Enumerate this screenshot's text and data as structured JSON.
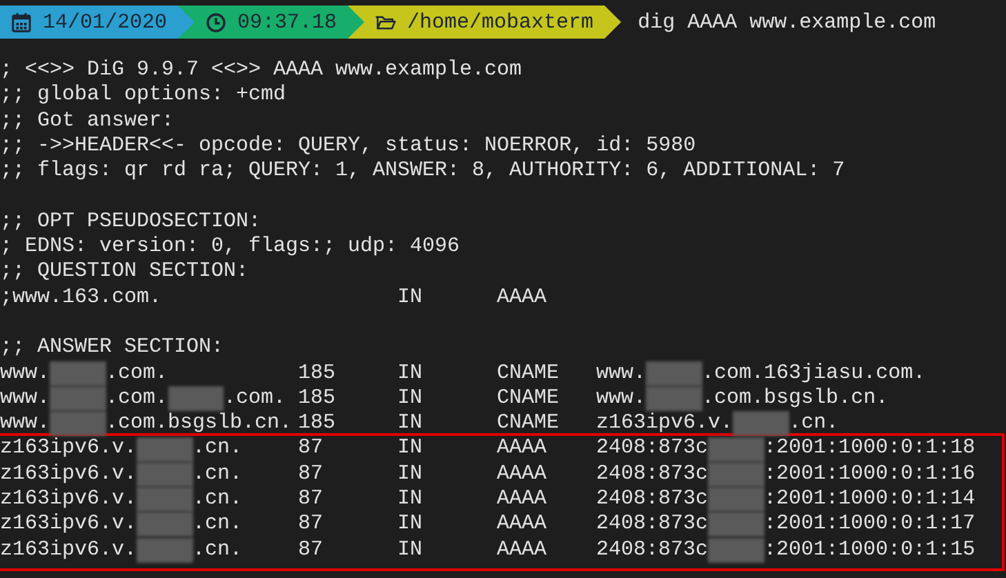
{
  "prompt": {
    "segments": [
      {
        "kind": "date",
        "text": "14/01/2020",
        "color": "#2a9fd0"
      },
      {
        "kind": "time",
        "text": "09:37.18",
        "color": "#17ad6a"
      },
      {
        "kind": "folder",
        "text": "/home/mobaxterm",
        "color": "#c5c51c"
      }
    ],
    "command": "dig AAAA www.example.com"
  },
  "header_lines": [
    "; <<>> DiG 9.9.7 <<>> AAAA www.example.com",
    ";; global options: +cmd",
    ";; Got answer:",
    ";; ->>HEADER<<- opcode: QUERY, status: NOERROR, id: 5980",
    ";; flags: qr rd ra; QUERY: 1, ANSWER: 8, AUTHORITY: 6, ADDITIONAL: 7"
  ],
  "opt_lines": [
    ";; OPT PSEUDOSECTION:",
    "; EDNS: version: 0, flags:; udp: 4096"
  ],
  "question": {
    "heading": ";; QUESTION SECTION:",
    "name": ";www.163.com.",
    "class": "IN",
    "type": "AAAA"
  },
  "answer": {
    "heading": ";; ANSWER SECTION:",
    "rows": [
      {
        "name": [
          {
            "kind": "text",
            "text": "www."
          },
          {
            "kind": "redacted"
          },
          {
            "kind": "text",
            "text": ".com."
          }
        ],
        "ttl": "185",
        "class": "IN",
        "type": "CNAME",
        "data": [
          {
            "kind": "text",
            "text": "www."
          },
          {
            "kind": "redacted"
          },
          {
            "kind": "text",
            "text": ".com.163jiasu.com."
          }
        ],
        "highlighted": false
      },
      {
        "name": [
          {
            "kind": "text",
            "text": "www."
          },
          {
            "kind": "redacted"
          },
          {
            "kind": "text",
            "text": ".com."
          },
          {
            "kind": "redacted"
          },
          {
            "kind": "text",
            "text": ".com."
          }
        ],
        "ttl": "185",
        "class": "IN",
        "type": "CNAME",
        "data": [
          {
            "kind": "text",
            "text": "www."
          },
          {
            "kind": "redacted"
          },
          {
            "kind": "text",
            "text": ".com.bsgslb.cn."
          }
        ],
        "highlighted": false
      },
      {
        "name": [
          {
            "kind": "text",
            "text": "www."
          },
          {
            "kind": "redacted"
          },
          {
            "kind": "text",
            "text": ".com.bsgslb.cn."
          }
        ],
        "ttl": "185",
        "class": "IN",
        "type": "CNAME",
        "data": [
          {
            "kind": "text",
            "text": "z163ipv6.v."
          },
          {
            "kind": "redacted"
          },
          {
            "kind": "text",
            "text": ".cn."
          }
        ],
        "highlighted": false
      },
      {
        "name": [
          {
            "kind": "text",
            "text": "z163ipv6.v."
          },
          {
            "kind": "redacted"
          },
          {
            "kind": "text",
            "text": ".cn."
          }
        ],
        "ttl": "87",
        "class": "IN",
        "type": "AAAA",
        "data": [
          {
            "kind": "text",
            "text": "2408:873c"
          },
          {
            "kind": "redacted"
          },
          {
            "kind": "text",
            "text": ":2001:1000:0:1:18"
          }
        ],
        "highlighted": true
      },
      {
        "name": [
          {
            "kind": "text",
            "text": "z163ipv6.v."
          },
          {
            "kind": "redacted"
          },
          {
            "kind": "text",
            "text": ".cn."
          }
        ],
        "ttl": "87",
        "class": "IN",
        "type": "AAAA",
        "data": [
          {
            "kind": "text",
            "text": "2408:873c"
          },
          {
            "kind": "redacted"
          },
          {
            "kind": "text",
            "text": ":2001:1000:0:1:16"
          }
        ],
        "highlighted": true
      },
      {
        "name": [
          {
            "kind": "text",
            "text": "z163ipv6.v."
          },
          {
            "kind": "redacted"
          },
          {
            "kind": "text",
            "text": ".cn."
          }
        ],
        "ttl": "87",
        "class": "IN",
        "type": "AAAA",
        "data": [
          {
            "kind": "text",
            "text": "2408:873c"
          },
          {
            "kind": "redacted"
          },
          {
            "kind": "text",
            "text": ":2001:1000:0:1:14"
          }
        ],
        "highlighted": true
      },
      {
        "name": [
          {
            "kind": "text",
            "text": "z163ipv6.v."
          },
          {
            "kind": "redacted"
          },
          {
            "kind": "text",
            "text": ".cn."
          }
        ],
        "ttl": "87",
        "class": "IN",
        "type": "AAAA",
        "data": [
          {
            "kind": "text",
            "text": "2408:873c"
          },
          {
            "kind": "redacted"
          },
          {
            "kind": "text",
            "text": ":2001:1000:0:1:17"
          }
        ],
        "highlighted": true
      },
      {
        "name": [
          {
            "kind": "text",
            "text": "z163ipv6.v."
          },
          {
            "kind": "redacted"
          },
          {
            "kind": "text",
            "text": ".cn."
          }
        ],
        "ttl": "87",
        "class": "IN",
        "type": "AAAA",
        "data": [
          {
            "kind": "text",
            "text": "2408:873c"
          },
          {
            "kind": "redacted"
          },
          {
            "kind": "text",
            "text": ":2001:1000:0:1:15"
          }
        ],
        "highlighted": true
      }
    ]
  }
}
